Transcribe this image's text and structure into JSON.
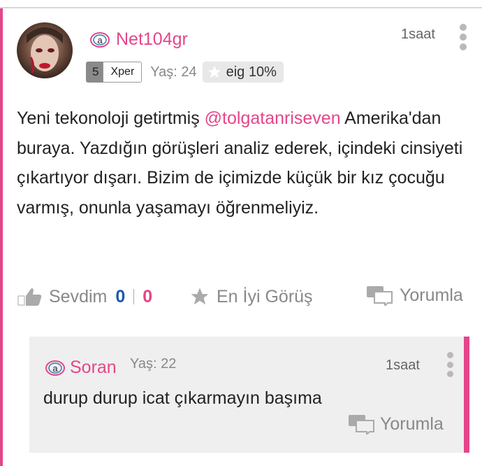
{
  "post": {
    "username": "Net104gr",
    "time": "1saat",
    "level": "5",
    "rank": "Xper",
    "age": "Yaş: 24",
    "eig": "eig 10%",
    "mention": "@tolgatanriseven",
    "body_before": "Yeni tekonoloji getirtmiş ",
    "body_after": " Amerika'dan buraya. Yazdığın görüşleri analiz ederek, içindeki cinsiyeti çıkartıyor dışarı. Bizim de içimizde küçük bir kız çocuğu varmış, onunla yaşamayı öğrenmeliyiz."
  },
  "actions": {
    "like_label": "Sevdim",
    "like_count": "0",
    "dislike_count": "0",
    "best_label": "En İyi Görüş",
    "reply_label": "Yorumla"
  },
  "reply": {
    "username": "Soran",
    "age": "Yaş: 22",
    "time": "1saat",
    "text": "durup durup icat çıkarmayın başıma",
    "reply_label": "Yorumla"
  },
  "icons": [
    "anonymous-icon",
    "more-vertical-icon",
    "star-icon",
    "thumbs-up-icon",
    "comment-icon"
  ],
  "colors": {
    "accent": "#e4468a",
    "like_count": "#1f5aa6",
    "muted": "#888888"
  }
}
